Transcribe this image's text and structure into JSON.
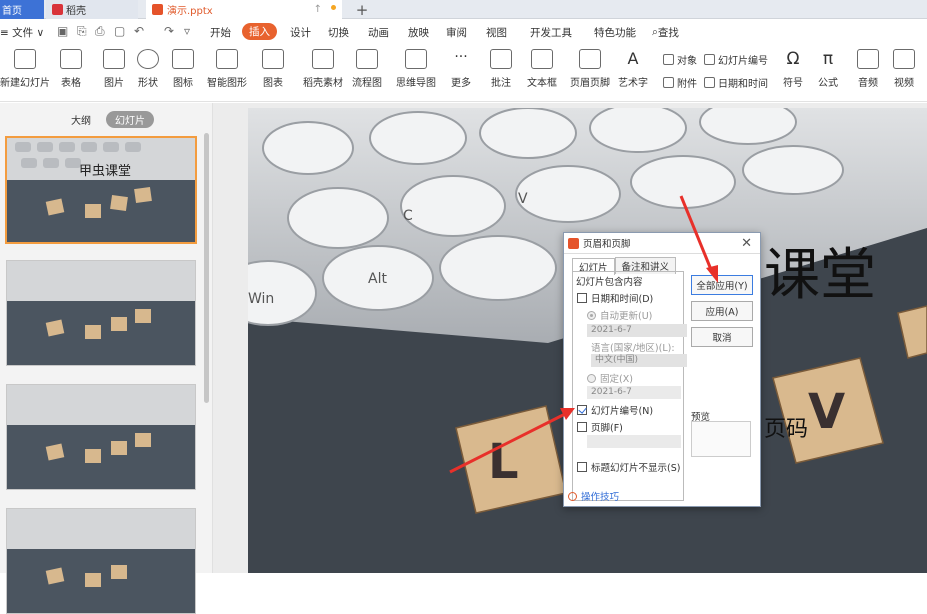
{
  "tabs": {
    "home": "首页",
    "daoke": "稻壳",
    "doc": "演示.pptx"
  },
  "menubar": {
    "file": "≡ 文件 ∨",
    "items": [
      "开始",
      "插入",
      "设计",
      "切换",
      "动画",
      "放映",
      "审阅",
      "视图",
      "开发工具",
      "特色功能"
    ],
    "active_index": 1,
    "search": "查找"
  },
  "ribbon": {
    "new_slide": "新建幻灯片",
    "table": "表格",
    "picture": "图片",
    "shape": "形状",
    "icon": "图标",
    "smart_graphic": "智能图形",
    "chart": "图表",
    "daoke_material": "稻壳素材",
    "flowchart": "流程图",
    "mindmap": "思维导图",
    "more": "更多",
    "comment": "批注",
    "textbox": "文本框",
    "header_footer": "页眉页脚",
    "art_text": "艺术字",
    "object": "对象",
    "attachment": "附件",
    "slide_number": "幻灯片编号",
    "date_time": "日期和时间",
    "symbol": "符号",
    "formula": "公式",
    "audio": "音频",
    "video": "视频"
  },
  "sidebar": {
    "outline": "大纲",
    "slides": "幻灯片",
    "thumb_title": "甲虫课堂"
  },
  "slide": {
    "title": "课堂",
    "subtitle": "页码"
  },
  "dialog": {
    "title": "页眉和页脚",
    "tab_slide": "幻灯片",
    "tab_notes": "备注和讲义",
    "group_label": "幻灯片包含内容",
    "date_time": "日期和时间(D)",
    "auto_update": "自动更新(U)",
    "date_value": "2021-6-7",
    "language": "语言(国家/地区)(L):",
    "language_value": "中文(中国)",
    "fixed": "固定(X)",
    "fixed_value": "2021-6-7",
    "slide_number": "幻灯片编号(N)",
    "footer": "页脚(F)",
    "hide_on_title": "标题幻灯片不显示(S)",
    "apply_all": "全部应用(Y)",
    "apply": "应用(A)",
    "cancel": "取消",
    "preview": "预览",
    "tips": "操作技巧",
    "slide_number_checked": true,
    "date_time_checked": false
  },
  "colors": {
    "accent": "#e8622e",
    "arrow": "#e8302a"
  }
}
